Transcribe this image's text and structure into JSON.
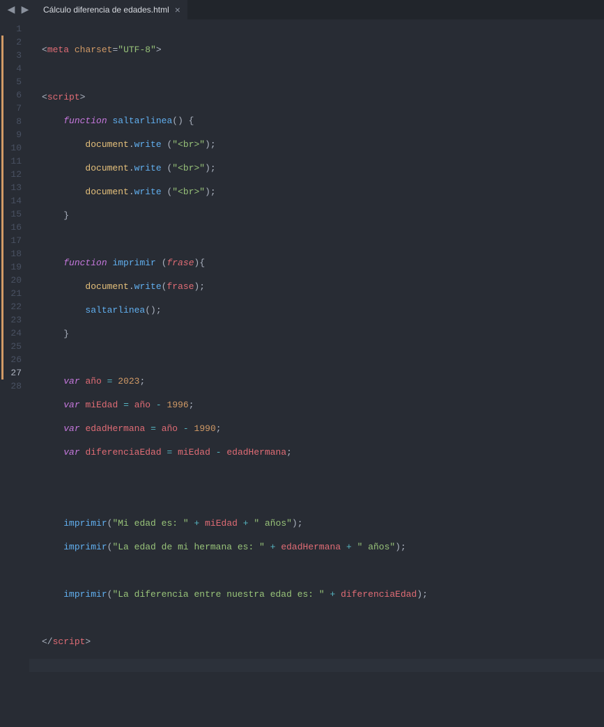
{
  "topbar": {
    "back": "◀",
    "forward": "▶",
    "tab_label": "Cálculo diferencia de edades.html",
    "tab_close": "×"
  },
  "gutter": {
    "lines": [
      "1",
      "2",
      "3",
      "4",
      "5",
      "6",
      "7",
      "8",
      "9",
      "10",
      "11",
      "12",
      "13",
      "14",
      "15",
      "16",
      "17",
      "18",
      "19",
      "20",
      "21",
      "22",
      "23",
      "24",
      "25",
      "26",
      "27",
      "28"
    ],
    "active_line": "27",
    "modified_lines": [
      "2",
      "3",
      "4",
      "5",
      "6",
      "7",
      "8",
      "9",
      "10",
      "11",
      "12",
      "13",
      "14",
      "15",
      "16",
      "17",
      "18",
      "19",
      "20",
      "21",
      "22",
      "23",
      "24",
      "25",
      "26",
      "27"
    ]
  },
  "code": {
    "l1": {
      "a": "<",
      "b": "meta",
      "c": " ",
      "d": "charset",
      "e": "=",
      "f": "\"UTF-8\"",
      "g": ">"
    },
    "l3": {
      "a": "<",
      "b": "script",
      "c": ">"
    },
    "l4": {
      "indent": "    ",
      "kw": "function",
      "sp": " ",
      "name": "saltarlinea",
      "paren": "() {"
    },
    "l5": {
      "indent": "        ",
      "obj": "document",
      "dot": ".",
      "fn": "write",
      "sp": " ",
      "open": "(",
      "str": "\"<br>\"",
      "close": ");"
    },
    "l6": {
      "indent": "        ",
      "obj": "document",
      "dot": ".",
      "fn": "write",
      "sp": " ",
      "open": "(",
      "str": "\"<br>\"",
      "close": ");"
    },
    "l7": {
      "indent": "        ",
      "obj": "document",
      "dot": ".",
      "fn": "write",
      "sp": " ",
      "open": "(",
      "str": "\"<br>\"",
      "close": ");"
    },
    "l8": {
      "indent": "    ",
      "brace": "}"
    },
    "l10": {
      "indent": "    ",
      "kw": "function",
      "sp": " ",
      "name": "imprimir",
      "sp2": " ",
      "open": "(",
      "param": "frase",
      "close": "){"
    },
    "l11": {
      "indent": "        ",
      "obj": "document",
      "dot": ".",
      "fn": "write",
      "open": "(",
      "arg": "frase",
      "close": ");"
    },
    "l12": {
      "indent": "        ",
      "fn": "saltarlinea",
      "call": "();"
    },
    "l13": {
      "indent": "    ",
      "brace": "}"
    },
    "l15": {
      "indent": "    ",
      "kw": "var",
      "sp": " ",
      "name": "año",
      "sp2": " ",
      "op": "=",
      "sp3": " ",
      "num": "2023",
      "semi": ";"
    },
    "l16": {
      "indent": "    ",
      "kw": "var",
      "sp": " ",
      "name": "miEdad",
      "sp2": " ",
      "op": "=",
      "sp3": " ",
      "v": "año",
      "sp4": " ",
      "op2": "-",
      "sp5": " ",
      "num": "1996",
      "semi": ";"
    },
    "l17": {
      "indent": "    ",
      "kw": "var",
      "sp": " ",
      "name": "edadHermana",
      "sp2": " ",
      "op": "=",
      "sp3": " ",
      "v": "año",
      "sp4": " ",
      "op2": "-",
      "sp5": " ",
      "num": "1990",
      "semi": ";"
    },
    "l18": {
      "indent": "    ",
      "kw": "var",
      "sp": " ",
      "name": "diferenciaEdad",
      "sp2": " ",
      "op": "=",
      "sp3": " ",
      "v": "miEdad",
      "sp4": " ",
      "op2": "-",
      "sp5": " ",
      "v2": "edadHermana",
      "semi": ";"
    },
    "l21": {
      "indent": "    ",
      "fn": "imprimir",
      "open": "(",
      "s1": "\"Mi edad es: \"",
      "sp": " ",
      "op": "+",
      "sp2": " ",
      "v": "miEdad",
      "sp3": " ",
      "op2": "+",
      "sp4": " ",
      "s2": "\" años\"",
      "close": ");"
    },
    "l22": {
      "indent": "    ",
      "fn": "imprimir",
      "open": "(",
      "s1": "\"La edad de mi hermana es: \"",
      "sp": " ",
      "op": "+",
      "sp2": " ",
      "v": "edadHermana",
      "sp3": " ",
      "op2": "+",
      "sp4": " ",
      "s2": "\" años\"",
      "close": ");"
    },
    "l24": {
      "indent": "    ",
      "fn": "imprimir",
      "open": "(",
      "s1": "\"La diferencia entre nuestra edad es: \"",
      "sp": " ",
      "op": "+",
      "sp2": " ",
      "v": "diferenciaEdad",
      "close": ");"
    },
    "l26": {
      "a": "</",
      "b": "script",
      "c": ">"
    }
  }
}
